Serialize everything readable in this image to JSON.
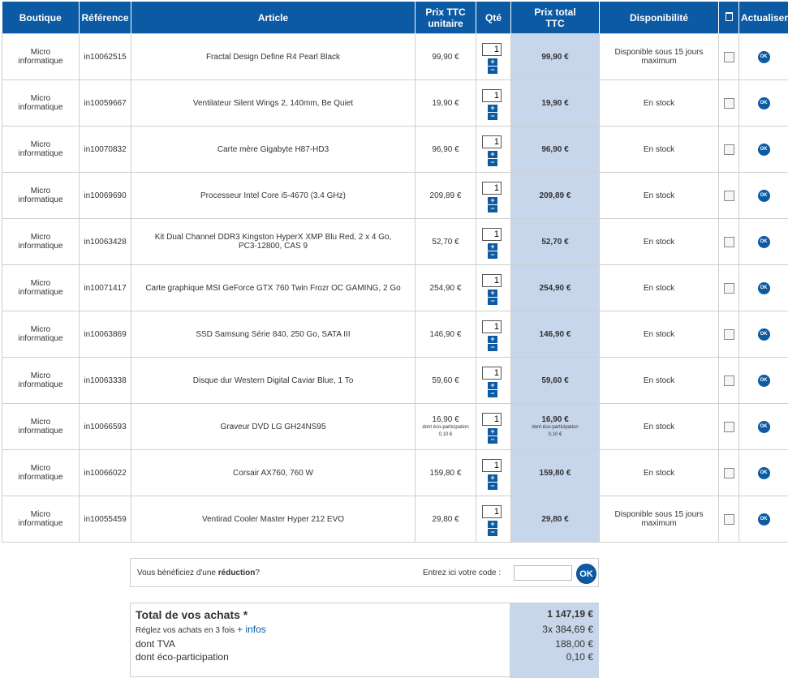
{
  "headers": {
    "boutique": "Boutique",
    "reference": "Référence",
    "article": "Article",
    "prix_unitaire_1": "Prix TTC",
    "prix_unitaire_2": "unitaire",
    "qte": "Qté",
    "prix_total_1": "Prix total",
    "prix_total_2": "TTC",
    "disponibilite": "Disponibilité",
    "delete_icon": "trash-icon",
    "actualiser": "Actualiser"
  },
  "rows": [
    {
      "boutique_1": "Micro",
      "boutique_2": "informatique",
      "ref": "in10062515",
      "article": "Fractal Design Define R4 Pearl Black",
      "unit": "99,90 €",
      "qty": "1",
      "total": "99,90 €",
      "dispo_1": "Disponible sous 15 jours",
      "dispo_2": "maximum"
    },
    {
      "boutique_1": "Micro",
      "boutique_2": "informatique",
      "ref": "in10059667",
      "article": "Ventilateur Silent Wings 2, 140mm, Be Quiet",
      "unit": "19,90 €",
      "qty": "1",
      "total": "19,90 €",
      "dispo_1": "En stock",
      "dispo_2": ""
    },
    {
      "boutique_1": "Micro",
      "boutique_2": "informatique",
      "ref": "in10070832",
      "article": "Carte mère Gigabyte H87-HD3",
      "unit": "96,90 €",
      "qty": "1",
      "total": "96,90 €",
      "dispo_1": "En stock",
      "dispo_2": ""
    },
    {
      "boutique_1": "Micro",
      "boutique_2": "informatique",
      "ref": "in10069690",
      "article": "Processeur Intel Core i5-4670 (3.4 GHz)",
      "unit": "209,89 €",
      "qty": "1",
      "total": "209,89 €",
      "dispo_1": "En stock",
      "dispo_2": ""
    },
    {
      "boutique_1": "Micro",
      "boutique_2": "informatique",
      "ref": "in10063428",
      "article": "Kit Dual Channel DDR3 Kingston HyperX XMP Blu Red, 2 x 4 Go,",
      "article_2": "PC3-12800, CAS 9",
      "unit": "52,70 €",
      "qty": "1",
      "total": "52,70 €",
      "dispo_1": "En stock",
      "dispo_2": ""
    },
    {
      "boutique_1": "Micro",
      "boutique_2": "informatique",
      "ref": "in10071417",
      "article": "Carte graphique MSI GeForce GTX 760 Twin Frozr OC GAMING, 2 Go",
      "unit": "254,90 €",
      "qty": "1",
      "total": "254,90 €",
      "dispo_1": "En stock",
      "dispo_2": ""
    },
    {
      "boutique_1": "Micro",
      "boutique_2": "informatique",
      "ref": "in10063869",
      "article": "SSD Samsung Série 840, 250 Go, SATA III",
      "unit": "146,90 €",
      "qty": "1",
      "total": "146,90 €",
      "dispo_1": "En stock",
      "dispo_2": ""
    },
    {
      "boutique_1": "Micro",
      "boutique_2": "informatique",
      "ref": "in10063338",
      "article": "Disque dur Western Digital Caviar Blue, 1 To",
      "unit": "59,60 €",
      "qty": "1",
      "total": "59,60 €",
      "dispo_1": "En stock",
      "dispo_2": ""
    },
    {
      "boutique_1": "Micro",
      "boutique_2": "informatique",
      "ref": "in10066593",
      "article": "Graveur DVD LG GH24NS95",
      "unit": "16,90 €",
      "unit_eco_1": "dont éco-participation",
      "unit_eco_2": "0,10 €",
      "qty": "1",
      "total": "16,90 €",
      "total_eco_1": "dont éco-participation",
      "total_eco_2": "0,10 €",
      "dispo_1": "En stock",
      "dispo_2": ""
    },
    {
      "boutique_1": "Micro",
      "boutique_2": "informatique",
      "ref": "in10066022",
      "article": "Corsair AX760, 760 W",
      "unit": "159,80 €",
      "qty": "1",
      "total": "159,80 €",
      "dispo_1": "En stock",
      "dispo_2": ""
    },
    {
      "boutique_1": "Micro",
      "boutique_2": "informatique",
      "ref": "in10055459",
      "article": "Ventirad Cooler Master Hyper 212 EVO",
      "unit": "29,80 €",
      "qty": "1",
      "total": "29,80 €",
      "dispo_1": "Disponible sous 15 jours",
      "dispo_2": "maximum"
    }
  ],
  "qty_plus": "+",
  "qty_minus": "−",
  "ok_label": "OK",
  "promo": {
    "msg_before": "Vous bénéficiez d'une ",
    "msg_bold": "réduction",
    "msg_after": "?",
    "code_label": "Entrez ici votre code :",
    "code_value": "",
    "ok": "OK"
  },
  "summary": {
    "title": "Total de vos achats *",
    "total": "1 147,19 €",
    "installments_text": "Réglez vos achats en 3 fois ",
    "installments_link": "+ infos",
    "installments_value": "3x  384,69 €",
    "tva_label": "dont TVA",
    "tva_value": "188,00 €",
    "eco_label": "dont éco-participation",
    "eco_value": "0,10 €"
  },
  "colors": {
    "header_blue": "#0c5aa4",
    "total_column": "#c7d6ea"
  }
}
